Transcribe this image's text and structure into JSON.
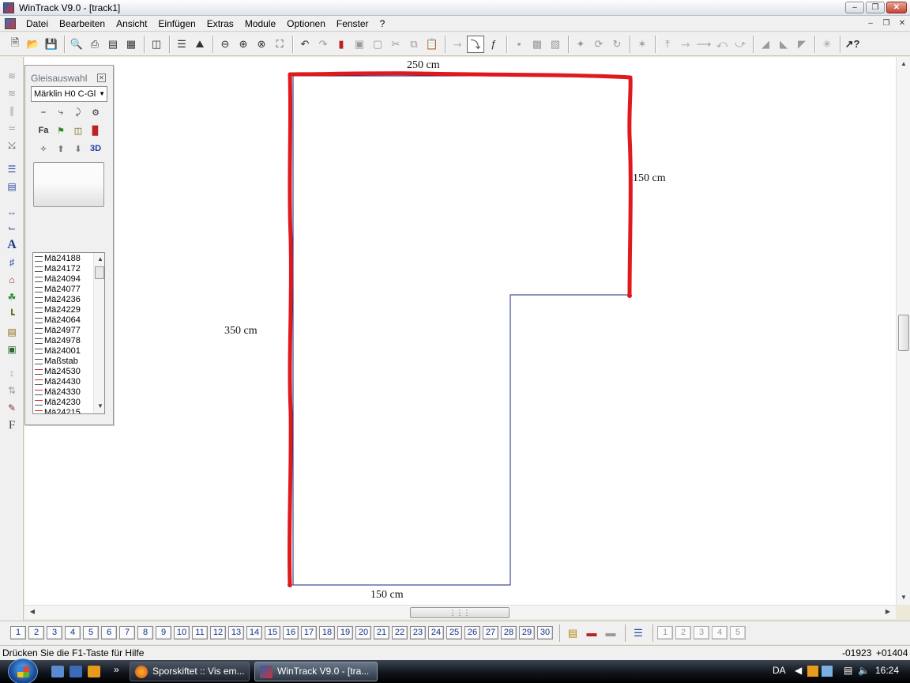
{
  "window": {
    "title": "WinTrack  V9.0 - [track1]"
  },
  "menu": {
    "items": [
      "Datei",
      "Bearbeiten",
      "Ansicht",
      "Einfügen",
      "Extras",
      "Module",
      "Optionen",
      "Fenster",
      "?"
    ]
  },
  "panel": {
    "title": "Gleisauswahl",
    "selected_system": "Märklin H0 C-Gl",
    "list_items": [
      "Mä24188",
      "Mä24172",
      "Mä24094",
      "Mä24077",
      "Mä24236",
      "Mä24229",
      "Mä24064",
      "Mä24977",
      "Mä24978",
      "Mä24001",
      "Maßstab",
      "Mä24530",
      "Mä24430",
      "Mä24330",
      "Mä24230",
      "Mä24215"
    ],
    "button_3d": "3D",
    "button_fa": "Fa"
  },
  "dimensions": {
    "top": "250 cm",
    "right": "150 cm",
    "left": "350 cm",
    "bottom": "150 cm"
  },
  "layers": [
    "1",
    "2",
    "3",
    "4",
    "5",
    "6",
    "7",
    "8",
    "9",
    "10",
    "11",
    "12",
    "13",
    "14",
    "15",
    "16",
    "17",
    "18",
    "19",
    "20",
    "21",
    "22",
    "23",
    "24",
    "25",
    "26",
    "27",
    "28",
    "29",
    "30"
  ],
  "layers_extra": [
    "1",
    "2",
    "3",
    "4",
    "5"
  ],
  "status": {
    "message": "Drücken Sie die  F1-Taste für Hilfe",
    "x": "-01923",
    "y": "+01404"
  },
  "taskbar": {
    "tasks": [
      "Sporskiftet :: Vis em...",
      "WinTrack  V9.0 - [tra..."
    ],
    "language": "DA",
    "time": "16:24"
  },
  "colors": {
    "room_outline": "#1a237e",
    "annotation": "#e0191c"
  }
}
